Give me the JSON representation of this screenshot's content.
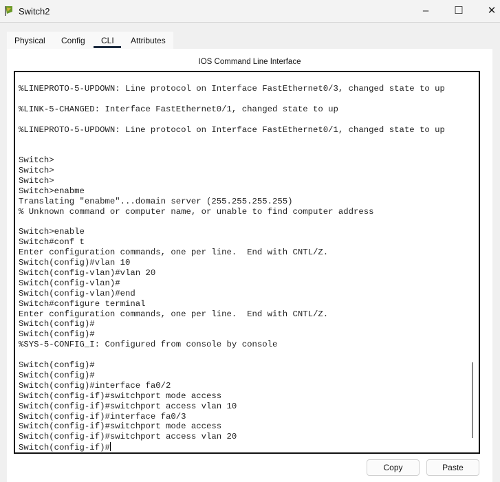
{
  "window": {
    "title": "Switch2",
    "icon": "packet-tracer-switch-icon",
    "controls": [
      "minimize",
      "maximize",
      "close"
    ]
  },
  "tabs": [
    {
      "label": "Physical"
    },
    {
      "label": "Config"
    },
    {
      "label": "CLI",
      "active": true
    },
    {
      "label": "Attributes"
    }
  ],
  "panel_title": "IOS Command Line Interface",
  "console_lines": [
    "%LINEPROTO-5-UPDOWN: Line protocol on Interface FastEthernet0/3, changed state to up",
    "",
    "%LINK-5-CHANGED: Interface FastEthernet0/1, changed state to up",
    "",
    "%LINEPROTO-5-UPDOWN: Line protocol on Interface FastEthernet0/1, changed state to up",
    "",
    "",
    "Switch>",
    "Switch>",
    "Switch>",
    "Switch>enabme",
    "Translating \"enabme\"...domain server (255.255.255.255)",
    "% Unknown command or computer name, or unable to find computer address",
    "",
    "Switch>enable",
    "Switch#conf t",
    "Enter configuration commands, one per line.  End with CNTL/Z.",
    "Switch(config)#vlan 10",
    "Switch(config-vlan)#vlan 20",
    "Switch(config-vlan)#",
    "Switch(config-vlan)#end",
    "Switch#configure terminal",
    "Enter configuration commands, one per line.  End with CNTL/Z.",
    "Switch(config)#",
    "Switch(config)#",
    "%SYS-5-CONFIG_I: Configured from console by console",
    "",
    "Switch(config)#",
    "Switch(config)#",
    "Switch(config)#interface fa0/2",
    "Switch(config-if)#switchport mode access",
    "Switch(config-if)#switchport access vlan 10",
    "Switch(config-if)#interface fa0/3",
    "Switch(config-if)#switchport mode access",
    "Switch(config-if)#switchport access vlan 20"
  ],
  "prompt": "Switch(config-if)#",
  "buttons": {
    "copy": "Copy",
    "paste": "Paste"
  }
}
